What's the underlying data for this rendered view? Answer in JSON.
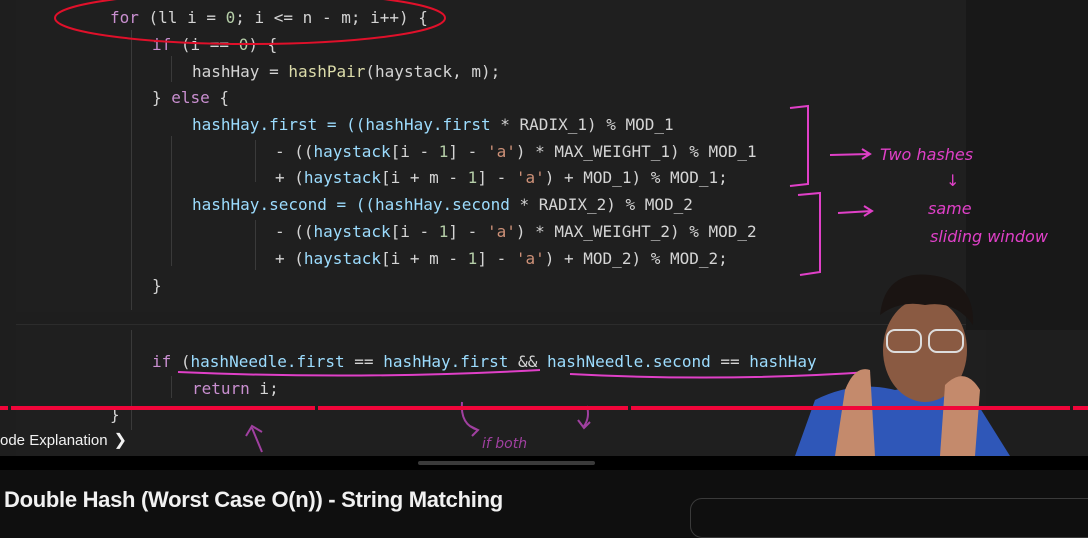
{
  "video": {
    "code_lines": [
      [
        {
          "t": "for",
          "c": "kw"
        },
        {
          "t": " (ll i = ",
          "c": "pl"
        },
        {
          "t": "0",
          "c": "num"
        },
        {
          "t": "; i <= n - m; i++) {",
          "c": "pl"
        }
      ],
      [
        {
          "t": "if",
          "c": "kw"
        },
        {
          "t": " (i == ",
          "c": "pl"
        },
        {
          "t": "0",
          "c": "num"
        },
        {
          "t": ") {",
          "c": "pl"
        }
      ],
      [
        {
          "t": "hashHay",
          "c": "pl"
        },
        {
          "t": " = ",
          "c": "pl"
        },
        {
          "t": "hashPair",
          "c": "fn"
        },
        {
          "t": "(haystack, m);",
          "c": "pl"
        }
      ],
      [
        {
          "t": "} ",
          "c": "pl"
        },
        {
          "t": "else",
          "c": "kw"
        },
        {
          "t": " {",
          "c": "pl"
        }
      ],
      [
        {
          "t": "hashHay",
          "c": "id"
        },
        {
          "t": ".first = ((",
          "c": "id"
        },
        {
          "t": "hashHay.first",
          "c": "id"
        },
        {
          "t": " * RADIX_1) % MOD_1",
          "c": "pl"
        }
      ],
      [
        {
          "t": "- ((",
          "c": "pl"
        },
        {
          "t": "haystack",
          "c": "id"
        },
        {
          "t": "[i - ",
          "c": "pl"
        },
        {
          "t": "1",
          "c": "num"
        },
        {
          "t": "] - ",
          "c": "pl"
        },
        {
          "t": "'a'",
          "c": "str"
        },
        {
          "t": ") * MAX_WEIGHT_1) % MOD_1",
          "c": "pl"
        }
      ],
      [
        {
          "t": "+ (",
          "c": "pl"
        },
        {
          "t": "haystack",
          "c": "id"
        },
        {
          "t": "[i + m - ",
          "c": "pl"
        },
        {
          "t": "1",
          "c": "num"
        },
        {
          "t": "] - ",
          "c": "pl"
        },
        {
          "t": "'a'",
          "c": "str"
        },
        {
          "t": ") + MOD_1) % MOD_1;",
          "c": "pl"
        }
      ],
      [
        {
          "t": "hashHay",
          "c": "id"
        },
        {
          "t": ".second = ((",
          "c": "id"
        },
        {
          "t": "hashHay.second",
          "c": "id"
        },
        {
          "t": " * RADIX_2) % MOD_2",
          "c": "pl"
        }
      ],
      [
        {
          "t": "- ((",
          "c": "pl"
        },
        {
          "t": "haystack",
          "c": "id"
        },
        {
          "t": "[i - ",
          "c": "pl"
        },
        {
          "t": "1",
          "c": "num"
        },
        {
          "t": "] - ",
          "c": "pl"
        },
        {
          "t": "'a'",
          "c": "str"
        },
        {
          "t": ") * MAX_WEIGHT_2) % MOD_2",
          "c": "pl"
        }
      ],
      [
        {
          "t": "+ (",
          "c": "pl"
        },
        {
          "t": "haystack",
          "c": "id"
        },
        {
          "t": "[i + m - ",
          "c": "pl"
        },
        {
          "t": "1",
          "c": "num"
        },
        {
          "t": "] - ",
          "c": "pl"
        },
        {
          "t": "'a'",
          "c": "str"
        },
        {
          "t": ") + MOD_2) % MOD_2;",
          "c": "pl"
        }
      ],
      [
        {
          "t": "}",
          "c": "pl"
        }
      ],
      [
        {
          "t": "if",
          "c": "kw"
        },
        {
          "t": " (",
          "c": "pl"
        },
        {
          "t": "hashNeedle.first",
          "c": "id"
        },
        {
          "t": " == ",
          "c": "pl"
        },
        {
          "t": "hashHay.first",
          "c": "id"
        },
        {
          "t": " && ",
          "c": "pl"
        },
        {
          "t": "hashNeedle.second",
          "c": "id"
        },
        {
          "t": " == ",
          "c": "pl"
        },
        {
          "t": "hashHay",
          "c": "id"
        }
      ],
      [
        {
          "t": "return",
          "c": "kw"
        },
        {
          "t": " i;",
          "c": "pl"
        }
      ],
      [
        {
          "t": "}",
          "c": "pl"
        }
      ]
    ],
    "annotations": {
      "two_hashes": "Two hashes",
      "arrow_down": "↓",
      "same": "same",
      "sliding_window": "sliding window",
      "if_both": "if both"
    },
    "chapter_label": "ode Explanation",
    "chapter_chevron": "❯",
    "progress_color": "#f0063a"
  },
  "title": "Double Hash (Worst Case O(n)) - String Matching"
}
